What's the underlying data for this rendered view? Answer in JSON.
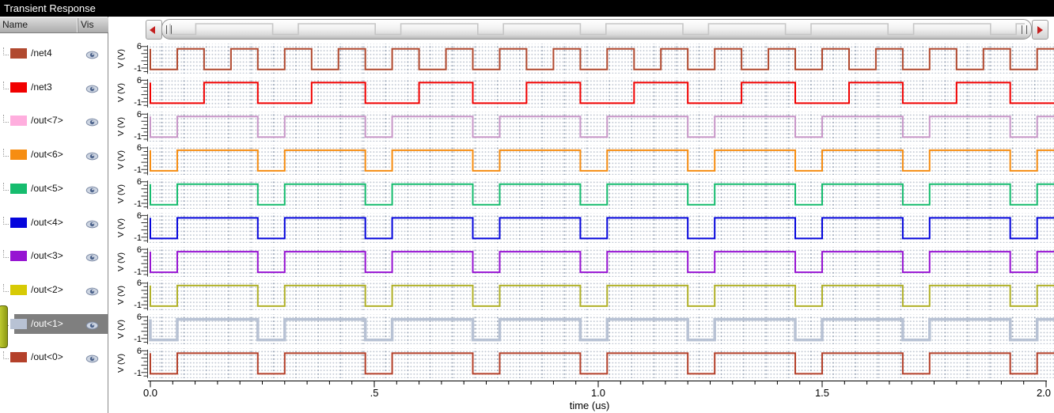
{
  "window": {
    "title": "Transient Response"
  },
  "panel": {
    "name_header": "Name",
    "vis_header": "Vis",
    "selected_signal": "/out<1>",
    "selected_row_bg": "#7f7f7f",
    "group_marker_color": "#a9b524"
  },
  "scrollbar": {
    "left_arrow_icon": "left-arrow",
    "right_arrow_icon": "right-arrow",
    "arrow_color": "#c41f1f",
    "overview_of": "/out<1>",
    "overview_line_color": "#c6c6c6"
  },
  "strip_axis": {
    "ylabel": "V (V)",
    "top_tick": "6",
    "bottom_tick": "-1"
  },
  "xaxis": {
    "label": "time (us)",
    "major_ticks": [
      {
        "t": 0,
        "label": "0.0"
      },
      {
        "t": 0.5,
        "label": ".5"
      },
      {
        "t": 1,
        "label": "1.0"
      },
      {
        "t": 1.5,
        "label": "1.5"
      },
      {
        "t": 2,
        "label": "2.0"
      }
    ],
    "minor_tick_step_us": 0.05
  },
  "plot": {
    "bg": "#ffffff",
    "grid_dot": "#c2c9d4",
    "grid_dot_major": "#96a2b4"
  },
  "chart_data": {
    "type": "line",
    "subtype": "digital-square-waveforms",
    "title": "Transient Response",
    "x_label": "time (us)",
    "x_range_us": [
      0,
      2
    ],
    "x_major_ticks_us": [
      0,
      0.5,
      1.0,
      1.5,
      2.0
    ],
    "strip_y_ticks": [
      6,
      -1
    ],
    "strip_y_label": "V (V)",
    "logic_high_v": 5,
    "logic_low_v": 0,
    "model_note": "every signal starts low at t=0; level is low while frac(t/period_us) < low_fraction, high otherwise",
    "series": [
      {
        "name": "/net4",
        "trace_color": "#b1492f",
        "swatch_color": "#b1492f",
        "period_us": 0.12,
        "low_fraction": 0.5,
        "selected": false,
        "visible": true
      },
      {
        "name": "/net3",
        "trace_color": "#f10000",
        "swatch_color": "#f10000",
        "period_us": 0.24,
        "low_fraction": 0.5,
        "selected": false,
        "visible": true
      },
      {
        "name": "/out<7>",
        "trace_color": "#c897c8",
        "swatch_color": "#ffaede",
        "period_us": 0.24,
        "low_fraction": 0.25,
        "selected": false,
        "visible": true
      },
      {
        "name": "/out<6>",
        "trace_color": "#f68d12",
        "swatch_color": "#f68d12",
        "period_us": 0.24,
        "low_fraction": 0.25,
        "selected": false,
        "visible": true
      },
      {
        "name": "/out<5>",
        "trace_color": "#16bc6e",
        "swatch_color": "#16bc6e",
        "period_us": 0.24,
        "low_fraction": 0.25,
        "selected": false,
        "visible": true
      },
      {
        "name": "/out<4>",
        "trace_color": "#0505dc",
        "swatch_color": "#0505dc",
        "period_us": 0.24,
        "low_fraction": 0.25,
        "selected": false,
        "visible": true
      },
      {
        "name": "/out<3>",
        "trace_color": "#9614d2",
        "swatch_color": "#9614d2",
        "period_us": 0.24,
        "low_fraction": 0.25,
        "selected": false,
        "visible": true
      },
      {
        "name": "/out<2>",
        "trace_color": "#b1b128",
        "swatch_color": "#d7ca05",
        "period_us": 0.24,
        "low_fraction": 0.25,
        "selected": false,
        "visible": true
      },
      {
        "name": "/out<1>",
        "trace_color": "#b8c2d4",
        "swatch_color": "#b8c2d4",
        "period_us": 0.24,
        "low_fraction": 0.25,
        "selected": true,
        "visible": true
      },
      {
        "name": "/out<0>",
        "trace_color": "#b4402a",
        "swatch_color": "#b4402a",
        "period_us": 0.24,
        "low_fraction": 0.25,
        "selected": false,
        "visible": true
      }
    ]
  }
}
